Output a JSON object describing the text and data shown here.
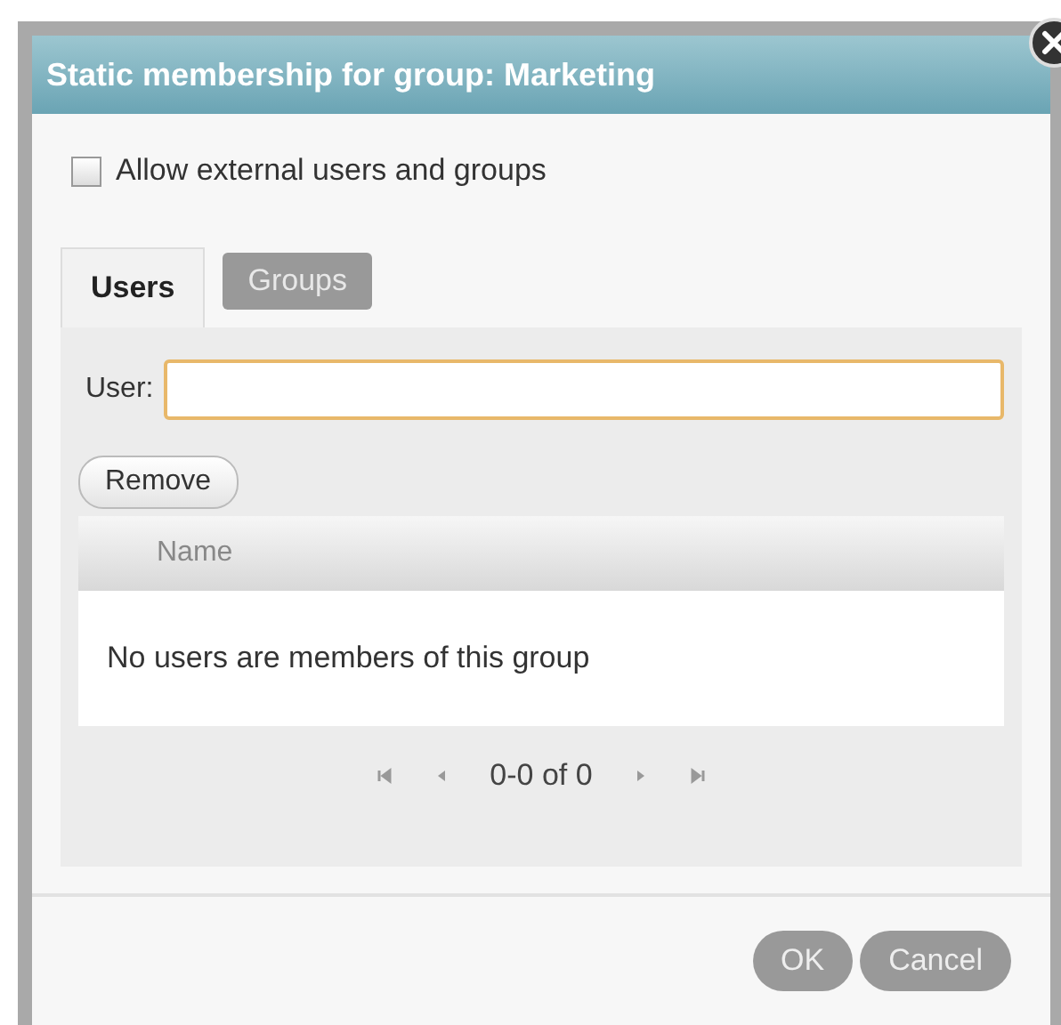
{
  "dialog": {
    "title": "Static membership for group: Marketing"
  },
  "allow_external": {
    "label": "Allow external users and groups",
    "checked": false
  },
  "tabs": [
    {
      "label": "Users",
      "selected": true
    },
    {
      "label": "Groups",
      "selected": false
    }
  ],
  "user_field": {
    "label": "User:"
  },
  "remove_button": "Remove",
  "table": {
    "columns": [
      "Name"
    ],
    "empty_message": "No users are members of this group"
  },
  "pager": {
    "range": "0-0 of 0"
  },
  "buttons": [
    {
      "label": "OK"
    },
    {
      "label": "Cancel"
    }
  ]
}
